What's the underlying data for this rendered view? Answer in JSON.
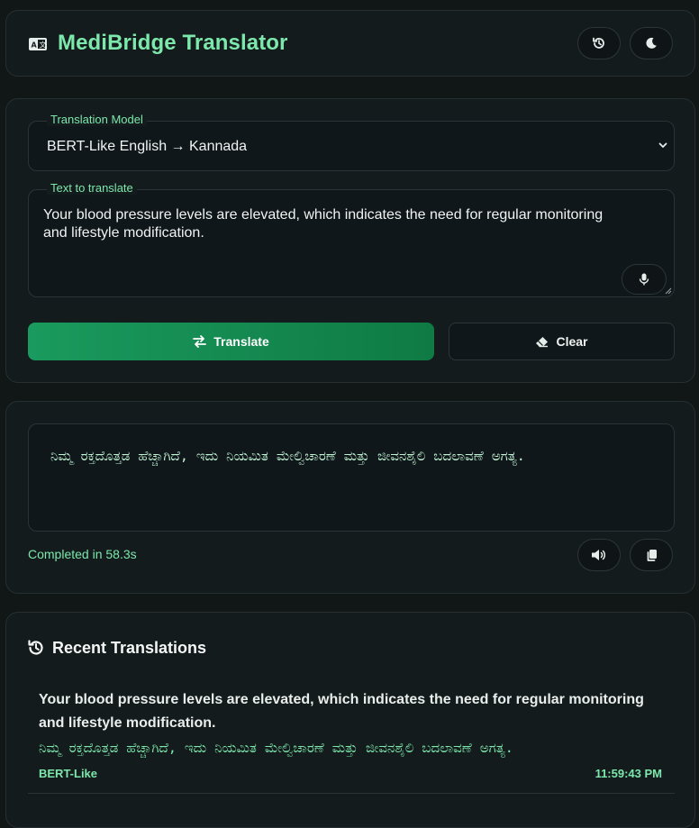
{
  "header": {
    "title": "MediBridge Translator",
    "app_icon": "translate-icon",
    "history_icon": "history-icon",
    "theme_icon": "moon-icon"
  },
  "form": {
    "model_label": "Translation Model",
    "model_value": "BERT-Like English → Kannada",
    "text_label": "Text to translate",
    "text_value": "Your blood pressure levels are elevated, which indicates the need for regular monitoring and lifestyle modification.",
    "mic_icon": "microphone-icon",
    "translate_label": "Translate",
    "clear_label": "Clear"
  },
  "output": {
    "translated_text": "ನಿಮ್ಮ ರಕ್ತದೊತ್ತಡ ಹೆಚ್ಚಾಗಿದೆ, ಇದು ನಿಯಮಿತ ಮೇಲ್ವಿಚಾರಣೆ ಮತ್ತು ಜೀವನಶೈಲಿ ಬದಲಾವಣೆ ಅಗತ್ಯ.",
    "status": "Completed in 58.3s",
    "speak_icon": "speaker-icon",
    "copy_icon": "copy-icon"
  },
  "recent": {
    "title": "Recent Translations",
    "entries": [
      {
        "source": "Your blood pressure levels are elevated, which indicates the need for regular monitoring and lifestyle modification.",
        "target": "ನಿಮ್ಮ ರಕ್ತದೊತ್ತಡ ಹೆಚ್ಚಾಗಿದೆ, ಇದು ನಿಯಮಿತ ಮೇಲ್ವಿಚಾರಣೆ ಮತ್ತು ಜೀವನಶೈಲಿ ಬದಲಾವಣೆ ಅಗತ್ಯ.",
        "model": "BERT-Like",
        "time": "11:59:43 PM"
      }
    ]
  },
  "colors": {
    "accent": "#7de8ac",
    "button_green": "#1a9a5e",
    "background": "#111617",
    "card": "#141b1d"
  }
}
